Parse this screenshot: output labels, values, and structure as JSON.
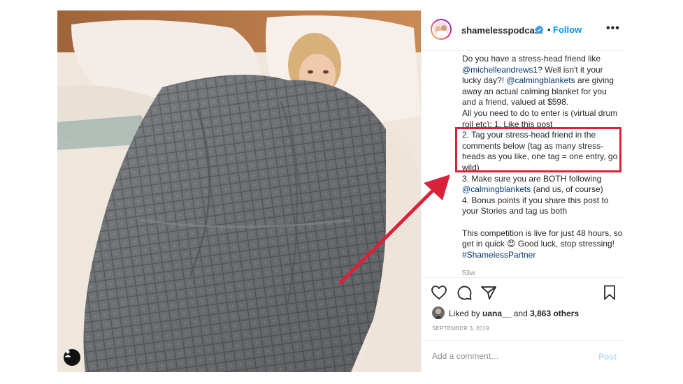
{
  "post": {
    "username": "shamelesspodcast",
    "dot": "•",
    "follow_label": "Follow",
    "more_label": "•••",
    "caption": {
      "intro_1": "Do you have a stress-head friend like ",
      "mention_1": "@michelleandrews1",
      "intro_2": "? Well isn't it your lucky day?! ",
      "mention_2": "@calmingblankets",
      "intro_3": " are giving away an actual calming blanket for you and a friend, valued at $598.",
      "line_enter": "All you need to do to enter is (virtual drum roll etc): 1. Like this post",
      "step_2": "2. Tag your stress-head friend in the comments below (tag as many stress-heads as you like, one tag = one entry, go wild)",
      "step_3a": "3. Make sure you are BOTH following ",
      "mention_3": "@calmingblankets",
      "step_3b": " (and us, of course)",
      "step_4": "4. Bonus points if you share this post to your Stories and tag us both",
      "closing_1": "This competition is live for just 48 hours, so get in quick ",
      "emoji": "😍",
      "closing_2": " Good luck, stop stressing! ",
      "hashtag": "#ShamelessPartner"
    },
    "time_ago": "53w",
    "likes": {
      "prefix": "Liked by ",
      "user": "uana__",
      "middle": " and ",
      "count": "3,863 others"
    },
    "date": "SEPTEMBER 3, 2019",
    "comment": {
      "placeholder": "Add a comment…",
      "post_label": "Post"
    },
    "icons": [
      "heart-icon",
      "comment-icon",
      "share-icon",
      "bookmark-icon",
      "verified-badge-icon",
      "user-tag-icon"
    ],
    "colors": {
      "link_blue": "#0095f6",
      "mention_blue": "#00376b",
      "annotation_red": "#d9223a",
      "blanket_gray": "#6c6f73"
    }
  }
}
